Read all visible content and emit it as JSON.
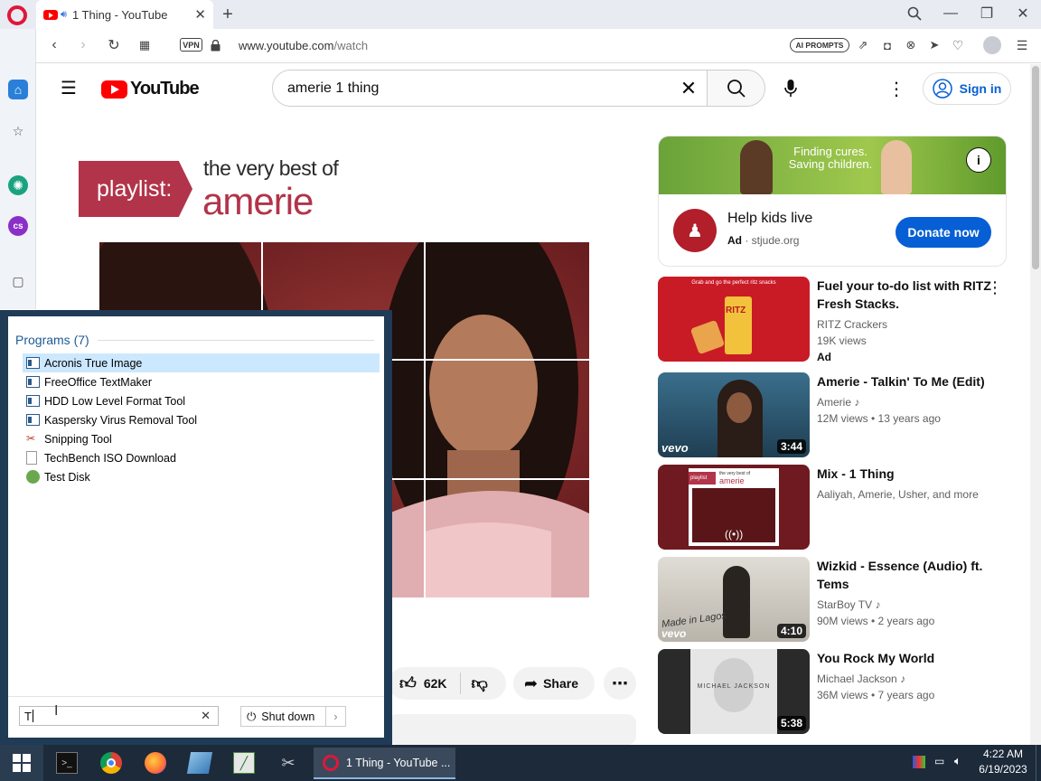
{
  "browser": {
    "tab_title": "1 Thing - YouTube",
    "new_tab": "+",
    "vpn_label": "VPN",
    "url_host": "www.youtube.com",
    "url_path": "/watch",
    "ai_prompts": "AI PROMPTS"
  },
  "youtube": {
    "logo_text": "YouTube",
    "search_value": "amerie 1 thing",
    "sign_in": "Sign in",
    "playlist_label": "playlist:",
    "playlist_line1": "the very best of",
    "playlist_line2": "amerie",
    "likes": "62K",
    "share": "Share"
  },
  "ad": {
    "banner_line1": "Finding cures.",
    "banner_line2": "Saving children.",
    "title": "Help kids live",
    "badge": "Ad",
    "domain": "stjude.org",
    "button": "Donate now"
  },
  "recommendations": [
    {
      "title": "Fuel your to-do list with RITZ Fresh Stacks.",
      "channel": "RITZ Crackers",
      "meta": "19K views",
      "extra": "Ad",
      "duration": ""
    },
    {
      "title": "Amerie - Talkin' To Me (Edit)",
      "channel": "Amerie",
      "meta": "12M views • 13 years ago",
      "extra": "",
      "duration": "3:44"
    },
    {
      "title": "Mix - 1 Thing",
      "channel": "Aaliyah, Amerie, Usher, and more",
      "meta": "",
      "extra": "",
      "duration": ""
    },
    {
      "title": "Wizkid - Essence (Audio) ft. Tems",
      "channel": "StarBoy TV",
      "meta": "90M views • 2 years ago",
      "extra": "",
      "duration": "4:10"
    },
    {
      "title": "You Rock My World",
      "channel": "Michael Jackson",
      "meta": "36M views • 7 years ago",
      "extra": "",
      "duration": "5:38"
    }
  ],
  "thumb_text": {
    "vevo": "vevo",
    "made_in_lagos": "Made in Lagos",
    "michael_jackson": "MICHAEL JACKSON",
    "ritz": "RITZ",
    "ritz_caption": "Grab and go the perfect ritz snacks",
    "mix_playlist": "playlist",
    "mix_small_line1": "the very best of",
    "mix_small_line2": "amerie"
  },
  "start_menu": {
    "header": "Programs (7)",
    "programs": [
      "Acronis True Image",
      "FreeOffice TextMaker",
      "HDD Low Level Format Tool",
      "Kaspersky Virus Removal Tool",
      "Snipping Tool",
      "TechBench ISO Download",
      "Test Disk"
    ],
    "search_value": "T",
    "shutdown": "Shut down"
  },
  "taskbar": {
    "active_task": "1 Thing - YouTube ...",
    "time": "4:22 AM",
    "date": "6/19/2023"
  }
}
